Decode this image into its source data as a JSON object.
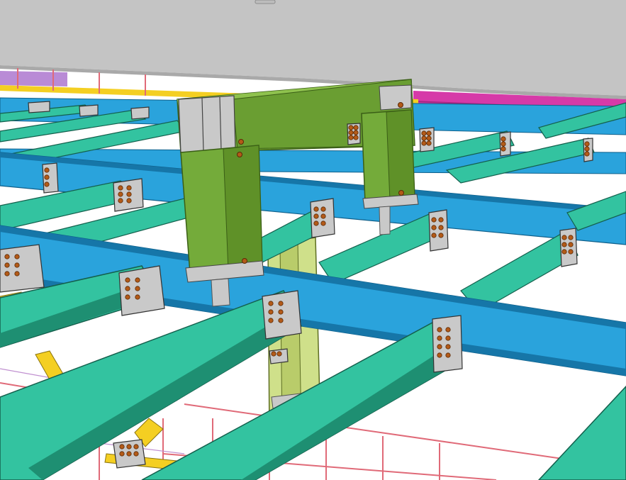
{
  "scene": {
    "kind": "3D steel framing model viewport",
    "colors": {
      "background": "#ffffff",
      "ceiling_slab": "#c4c4c4",
      "main_girder": "#2aa3dc",
      "main_girder_dark": "#1676a8",
      "joist": "#33c3a0",
      "joist_dark": "#1e8f72",
      "column_green": "#74ab3a",
      "column_green_dark": "#4e7c21",
      "column_light": "#cfe08a",
      "magenta_beams": "#d63aa8",
      "purple_beam": "#b98bd6",
      "yellow_brace": "#f4cf22",
      "plate": "#c9c9c9",
      "bolt": "#b35a18",
      "grid_red": "#e06a78",
      "grid_purple": "#c090d0"
    },
    "icons": [
      "bolt-icon"
    ]
  }
}
